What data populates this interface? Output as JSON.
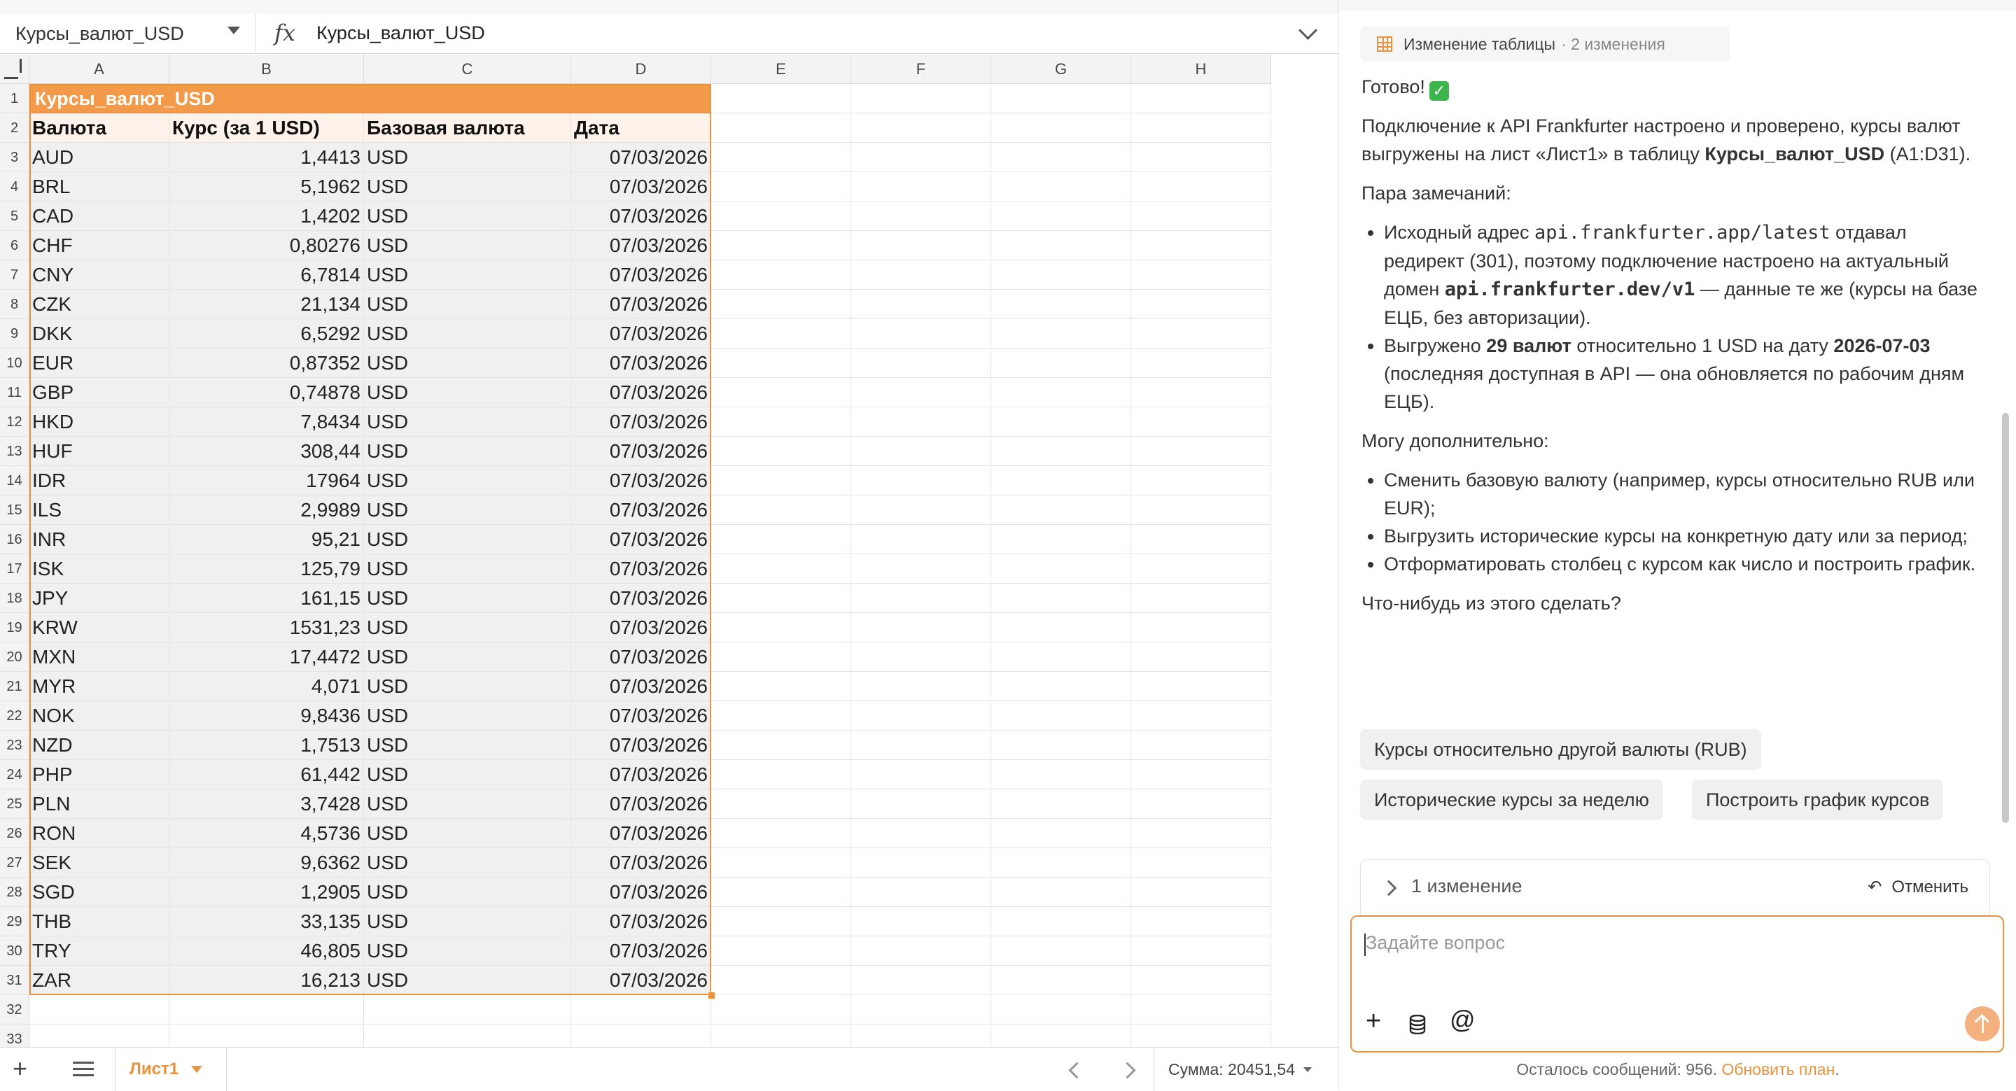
{
  "sheet": {
    "name_box": "Курсы_валют_USD",
    "formula_icon": "fx",
    "formula": "Курсы_валют_USD",
    "columns": [
      "A",
      "B",
      "C",
      "D",
      "E",
      "F",
      "G",
      "H"
    ],
    "title": "Курсы_валют_USD",
    "headers": [
      "Валюта",
      "Курс (за 1 USD)",
      "Базовая валюта",
      "Дата"
    ],
    "rows": [
      [
        "AUD",
        "1,4413",
        "USD",
        "07/03/2026"
      ],
      [
        "BRL",
        "5,1962",
        "USD",
        "07/03/2026"
      ],
      [
        "CAD",
        "1,4202",
        "USD",
        "07/03/2026"
      ],
      [
        "CHF",
        "0,80276",
        "USD",
        "07/03/2026"
      ],
      [
        "CNY",
        "6,7814",
        "USD",
        "07/03/2026"
      ],
      [
        "CZK",
        "21,134",
        "USD",
        "07/03/2026"
      ],
      [
        "DKK",
        "6,5292",
        "USD",
        "07/03/2026"
      ],
      [
        "EUR",
        "0,87352",
        "USD",
        "07/03/2026"
      ],
      [
        "GBP",
        "0,74878",
        "USD",
        "07/03/2026"
      ],
      [
        "HKD",
        "7,8434",
        "USD",
        "07/03/2026"
      ],
      [
        "HUF",
        "308,44",
        "USD",
        "07/03/2026"
      ],
      [
        "IDR",
        "17964",
        "USD",
        "07/03/2026"
      ],
      [
        "ILS",
        "2,9989",
        "USD",
        "07/03/2026"
      ],
      [
        "INR",
        "95,21",
        "USD",
        "07/03/2026"
      ],
      [
        "ISK",
        "125,79",
        "USD",
        "07/03/2026"
      ],
      [
        "JPY",
        "161,15",
        "USD",
        "07/03/2026"
      ],
      [
        "KRW",
        "1531,23",
        "USD",
        "07/03/2026"
      ],
      [
        "MXN",
        "17,4472",
        "USD",
        "07/03/2026"
      ],
      [
        "MYR",
        "4,071",
        "USD",
        "07/03/2026"
      ],
      [
        "NOK",
        "9,8436",
        "USD",
        "07/03/2026"
      ],
      [
        "NZD",
        "1,7513",
        "USD",
        "07/03/2026"
      ],
      [
        "PHP",
        "61,442",
        "USD",
        "07/03/2026"
      ],
      [
        "PLN",
        "3,7428",
        "USD",
        "07/03/2026"
      ],
      [
        "RON",
        "4,5736",
        "USD",
        "07/03/2026"
      ],
      [
        "SEK",
        "9,6362",
        "USD",
        "07/03/2026"
      ],
      [
        "SGD",
        "1,2905",
        "USD",
        "07/03/2026"
      ],
      [
        "THB",
        "33,135",
        "USD",
        "07/03/2026"
      ],
      [
        "TRY",
        "46,805",
        "USD",
        "07/03/2026"
      ],
      [
        "ZAR",
        "16,213",
        "USD",
        "07/03/2026"
      ]
    ],
    "empty_rows": [
      "32",
      "33"
    ],
    "tab_name": "Лист1",
    "sum": "Сумма: 20451,54"
  },
  "chat": {
    "change_chip": {
      "label": "Изменение таблицы",
      "count": "· 2 изменения"
    },
    "msg_ready": "Готово!",
    "msg_ready_icon": "✓",
    "p1_a": "Подключение к API Frankfurter настроено и проверено, курсы валют выгружены на лист «Лист1» в таблицу ",
    "p1_b": "Курсы_валют_USD",
    "p1_c": " (A1:D31).",
    "p2": "Пара замечаний:",
    "b1_a": "Исходный адрес ",
    "b1_b": "api.frankfurter.app/latest",
    "b1_c": " отдавал редирект (301), поэтому подключение настроено на актуальный домен ",
    "b1_d": "api.frankfurter.dev/v1",
    "b1_e": " — данные те же (курсы на базе ЕЦБ, без авторизации).",
    "b2_a": "Выгружено ",
    "b2_b": "29 валют",
    "b2_c": " относительно 1 USD на дату ",
    "b2_d": "2026-07-03",
    "b2_e": " (последняя доступная в API — она обновляется по рабочим дням ЕЦБ).",
    "p3": "Могу дополнительно:",
    "b3": "Сменить базовую валюту (например, курсы относительно RUB или EUR);",
    "b4": "Выгрузить исторические курсы на конкретную дату или за период;",
    "b5": "Отформатировать столбец с курсом как число и построить график.",
    "p4": "Что-нибудь из этого сделать?",
    "suggestions": [
      "Курсы относительно другой валюты (RUB)",
      "Исторические курсы за неделю",
      "Построить график курсов"
    ],
    "changes_label": "1 изменение",
    "undo_label": "Отменить",
    "input_placeholder": "Задайте вопрос",
    "footer_text": "Осталось сообщений: 956. ",
    "footer_link": "Обновить план",
    "footer_dot": "."
  },
  "colors": {
    "accent": "#e8913f",
    "title_fill": "#f2994a",
    "header_fill": "#fdf3ea"
  }
}
